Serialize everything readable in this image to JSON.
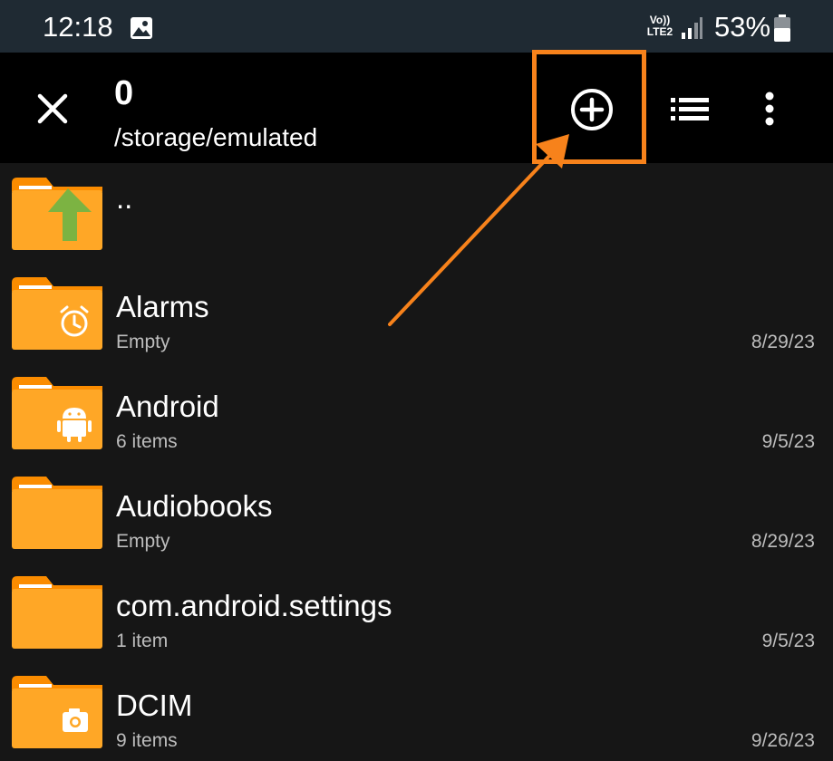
{
  "status_bar": {
    "time": "12:18",
    "volte_line1": "Vo))",
    "volte_line2": "LTE2",
    "battery_percent": "53%"
  },
  "toolbar": {
    "selected_count": "0",
    "path": "/storage/emulated"
  },
  "colors": {
    "accent": "#f7821b",
    "folder": "#ffa726",
    "folder_tab": "#fb8c00",
    "up_arrow": "#7cb342"
  },
  "files": {
    "up": {
      "name": ".."
    },
    "items": [
      {
        "name": "Alarms",
        "meta": "Empty",
        "date": "8/29/23",
        "icon": "alarm-clock-icon"
      },
      {
        "name": "Android",
        "meta": "6 items",
        "date": "9/5/23",
        "icon": "android-icon"
      },
      {
        "name": "Audiobooks",
        "meta": "Empty",
        "date": "8/29/23",
        "icon": ""
      },
      {
        "name": "com.android.settings",
        "meta": "1 item",
        "date": "9/5/23",
        "icon": ""
      },
      {
        "name": "DCIM",
        "meta": "9 items",
        "date": "9/26/23",
        "icon": "camera-icon"
      }
    ]
  }
}
